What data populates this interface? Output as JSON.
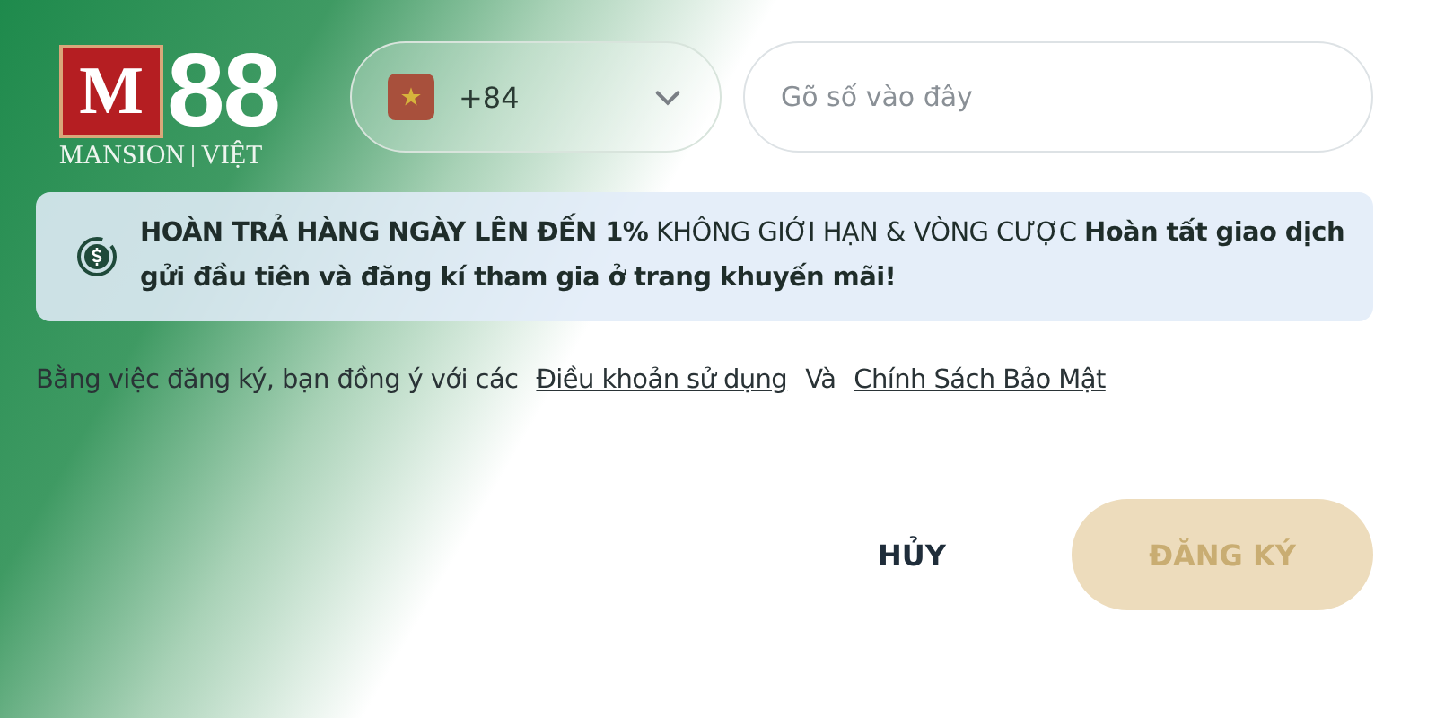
{
  "logo": {
    "mark": "M",
    "number": "88",
    "brand": "MANSION",
    "region": "VIỆT"
  },
  "phone": {
    "country_code": "+84",
    "placeholder": "Gõ số vào đây"
  },
  "promo": {
    "text": "**HOÀN TRẢ HÀNG NGÀY LÊN ĐẾN 1%** KHÔNG GIỚI HẠN & VÒNG CƯỢC **Hoàn tất giao dịch gửi đầu tiên và đăng kí tham gia ở trang khuyến mãi!**"
  },
  "terms": {
    "text": "Bằng việc đăng ký, bạn đồng ý với các",
    "link_1": "Điều khoản sử dụng",
    "joiner": "Và",
    "link_2": "Chính Sách Bảo Mật"
  },
  "buttons": [
    {
      "kind": "text",
      "label": "HỦY",
      "disabled": false
    },
    {
      "kind": "primary",
      "label": "ĐĂNG KÝ",
      "disabled": true
    }
  ]
}
